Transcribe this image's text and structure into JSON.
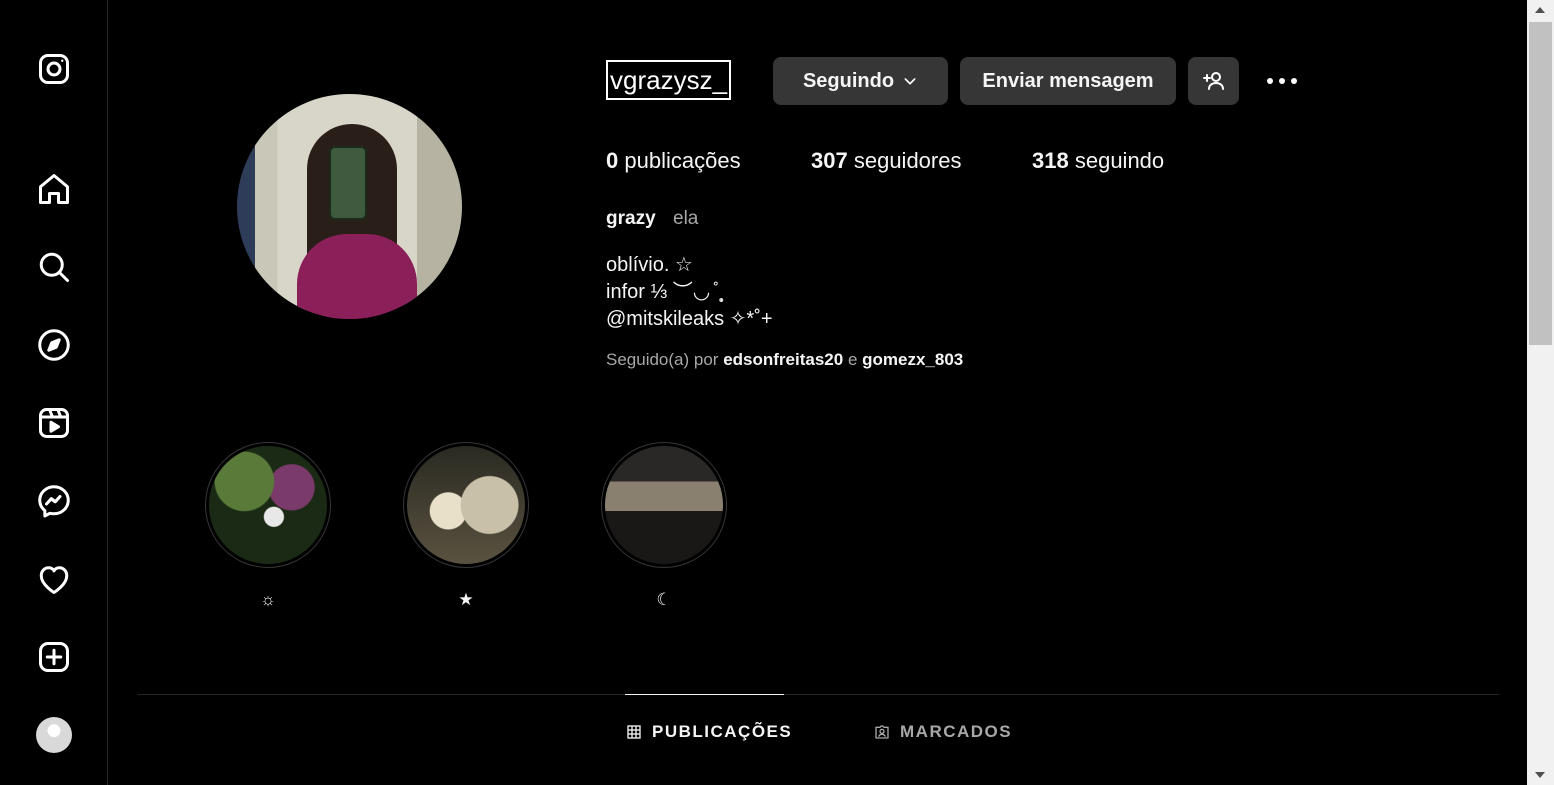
{
  "sidebar": {
    "items": [
      {
        "name": "instagram-logo-icon"
      },
      {
        "name": "home-icon"
      },
      {
        "name": "search-icon"
      },
      {
        "name": "explore-icon"
      },
      {
        "name": "reels-icon"
      },
      {
        "name": "messenger-icon"
      },
      {
        "name": "heart-icon"
      },
      {
        "name": "create-icon"
      },
      {
        "name": "profile-avatar-icon"
      }
    ]
  },
  "profile": {
    "username": "vgrazysz_",
    "following_button": "Seguindo",
    "message_button": "Enviar mensagem",
    "stats": {
      "posts_count": "0",
      "posts_label": "publicações",
      "followers_count": "307",
      "followers_label": "seguidores",
      "following_count": "318",
      "following_label": "seguindo"
    },
    "full_name": "grazy",
    "pronouns": "ela",
    "bio_lines": [
      "oblívio. ☆",
      "infor ⅓ ︶◡ ̊ ̩̥",
      "@mitskileaks ✧*˚+"
    ],
    "followed_by": {
      "prefix": "Seguido(a) por",
      "user1": "edsonfreitas20",
      "conjunction": "e",
      "user2": "gomezx_803"
    }
  },
  "highlights": [
    {
      "label": "☼"
    },
    {
      "label": "★"
    },
    {
      "label": "☾"
    }
  ],
  "tabs": {
    "posts": "PUBLICAÇÕES",
    "tagged": "MARCADOS"
  },
  "colors": {
    "background": "#000000",
    "button": "#363636",
    "muted_text": "#a8a8a8",
    "divider": "#262626"
  }
}
